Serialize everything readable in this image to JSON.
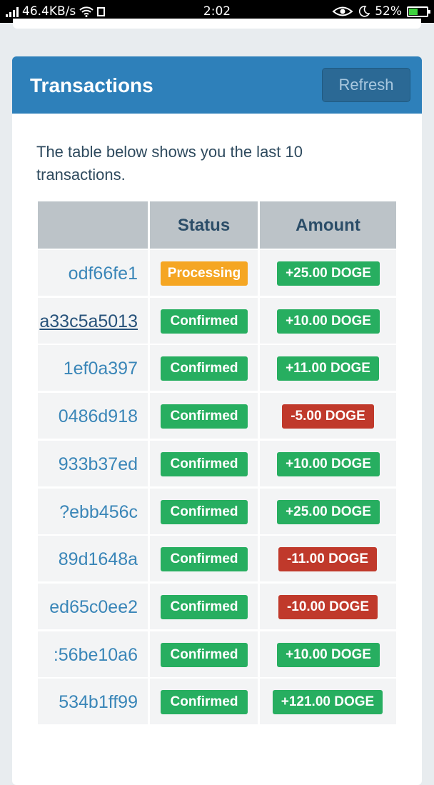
{
  "status_bar": {
    "net_speed": "46.4KB/s",
    "time": "2:02",
    "battery": "52%",
    "battery_level": 0.52,
    "icons": [
      "signal-icon",
      "wifi-icon",
      "notification-icon",
      "eye-icon",
      "moon-icon",
      "battery-icon"
    ]
  },
  "panel": {
    "title": "Transactions",
    "refresh_label": "Refresh",
    "description": "The table below shows you the last 10 transactions."
  },
  "table": {
    "columns": [
      "",
      "Status",
      "Amount"
    ],
    "rows": [
      {
        "hash": "odf66fe1",
        "status": "Processing",
        "amount": "+25.00 DOGE",
        "kind": "processing",
        "sign": "positive"
      },
      {
        "hash": "a33c5a5013",
        "status": "Confirmed",
        "amount": "+10.00 DOGE",
        "kind": "confirmed",
        "sign": "positive",
        "linked": true
      },
      {
        "hash": "1ef0a397",
        "status": "Confirmed",
        "amount": "+11.00 DOGE",
        "kind": "confirmed",
        "sign": "positive"
      },
      {
        "hash": "0486d918",
        "status": "Confirmed",
        "amount": "-5.00 DOGE",
        "kind": "confirmed",
        "sign": "negative"
      },
      {
        "hash": "933b37ed",
        "status": "Confirmed",
        "amount": "+10.00 DOGE",
        "kind": "confirmed",
        "sign": "positive"
      },
      {
        "hash": "?ebb456c",
        "status": "Confirmed",
        "amount": "+25.00 DOGE",
        "kind": "confirmed",
        "sign": "positive"
      },
      {
        "hash": "89d1648a",
        "status": "Confirmed",
        "amount": "-11.00 DOGE",
        "kind": "confirmed",
        "sign": "negative"
      },
      {
        "hash": "ed65c0ee2",
        "status": "Confirmed",
        "amount": "-10.00 DOGE",
        "kind": "confirmed",
        "sign": "negative"
      },
      {
        "hash": ":56be10a6",
        "status": "Confirmed",
        "amount": "+10.00 DOGE",
        "kind": "confirmed",
        "sign": "positive"
      },
      {
        "hash": "534b1ff99",
        "status": "Confirmed",
        "amount": "+121.00 DOGE",
        "kind": "confirmed",
        "sign": "positive"
      }
    ]
  },
  "colors": {
    "header_blue": "#2e80ba",
    "processing": "#f5a623",
    "confirmed": "#27ae60",
    "positive": "#27ae60",
    "negative": "#c0392b"
  }
}
